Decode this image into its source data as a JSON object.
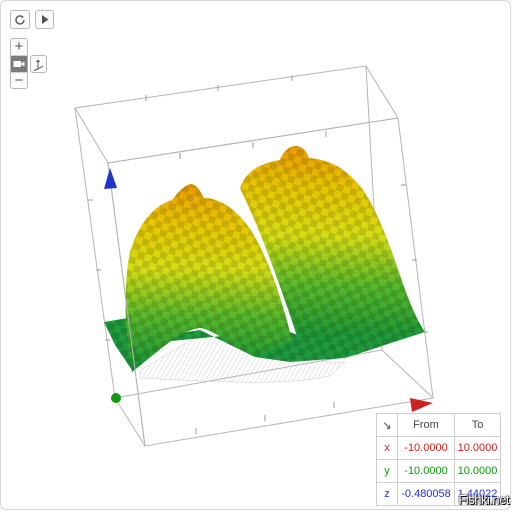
{
  "toolbar": {
    "refresh_icon": "refresh-icon",
    "play_icon": "play-icon",
    "zoom_in_label": "+",
    "zoom_out_label": "−",
    "camera_icon": "camera-icon",
    "axes_icon": "axes-icon"
  },
  "colors": {
    "x_axis": "#cc2222",
    "y_axis": "#119911",
    "z_axis": "#2233cc",
    "surface_high": "#e8a000",
    "surface_mid": "#d8dc10",
    "surface_low": "#1e9a3c"
  },
  "ranges": {
    "corner_icon": "↘",
    "header_from": "From",
    "header_to": "To",
    "rows": [
      {
        "axis": "x",
        "from": "-10.0000",
        "to": "10.0000",
        "color": "#cc2222"
      },
      {
        "axis": "y",
        "from": "-10.0000",
        "to": "10.0000",
        "color": "#119911"
      },
      {
        "axis": "z",
        "from": "-0.480058",
        "to": "1.44022",
        "color": "#2233cc"
      }
    ]
  },
  "watermark": "Fishki.net"
}
